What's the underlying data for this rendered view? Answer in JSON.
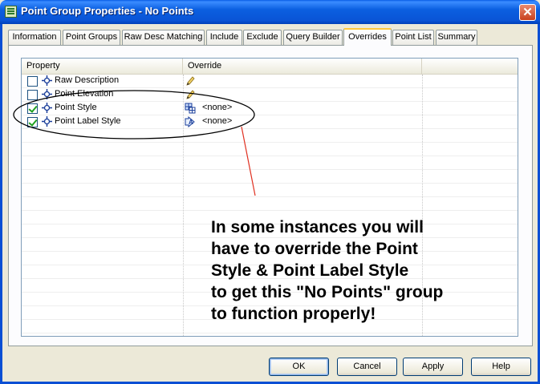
{
  "window": {
    "title": "Point Group Properties - No Points",
    "close_label": "✕"
  },
  "tabs": [
    {
      "label": "Information"
    },
    {
      "label": "Point Groups"
    },
    {
      "label": "Raw Desc Matching"
    },
    {
      "label": "Include"
    },
    {
      "label": "Exclude"
    },
    {
      "label": "Query Builder"
    },
    {
      "label": "Overrides",
      "active": true
    },
    {
      "label": "Point List"
    },
    {
      "label": "Summary"
    }
  ],
  "grid": {
    "columns": [
      "Property",
      "Override"
    ],
    "rows": [
      {
        "label": "Raw Description",
        "checked": false,
        "override_icon": "pencil-icon",
        "override_value": ""
      },
      {
        "label": "Point Elevation",
        "checked": false,
        "override_icon": "pencil-icon",
        "override_value": ""
      },
      {
        "label": "Point Style",
        "checked": true,
        "override_icon": "point-style-icon",
        "override_value": "<none>"
      },
      {
        "label": "Point Label Style",
        "checked": true,
        "override_icon": "label-style-icon",
        "override_value": "<none>"
      }
    ]
  },
  "annotation": {
    "lines": [
      "In some instances you will",
      "have to override the Point",
      "Style & Point Label Style",
      "to get this \"No Points\" group",
      "to function properly!"
    ]
  },
  "buttons": {
    "ok": "OK",
    "cancel": "Cancel",
    "apply": "Apply",
    "help": "Help"
  },
  "colors": {
    "titlebar": "#0a5ee6",
    "active_tab_highlight": "#ffc83c",
    "checkmark": "#21a121",
    "annotation_ellipse": "#000000",
    "annotation_line": "#e03020"
  }
}
